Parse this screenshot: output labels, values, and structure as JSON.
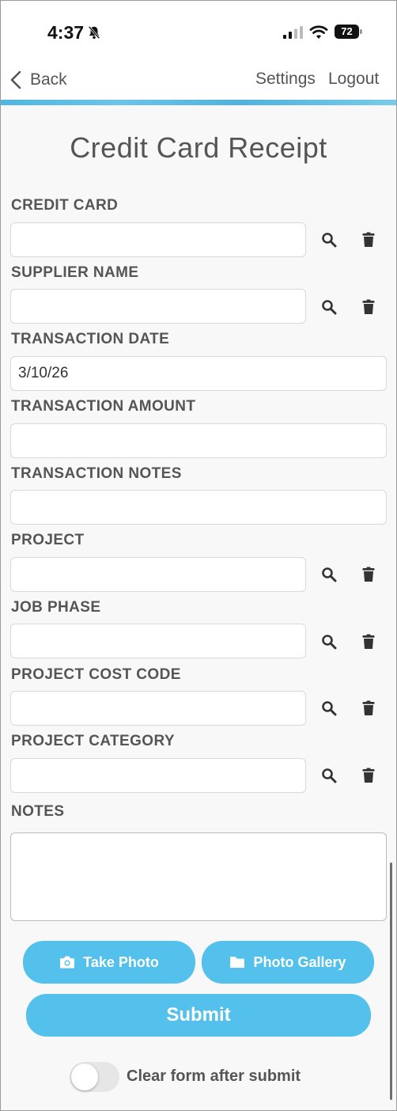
{
  "status_bar": {
    "time": "4:37",
    "battery": "72"
  },
  "nav": {
    "back_label": "Back",
    "settings_label": "Settings",
    "logout_label": "Logout"
  },
  "page_title": "Credit Card Receipt",
  "fields": {
    "credit_card": {
      "label": "CREDIT CARD",
      "value": ""
    },
    "supplier_name": {
      "label": "SUPPLIER NAME",
      "value": ""
    },
    "transaction_date": {
      "label": "TRANSACTION DATE",
      "value": "3/10/26"
    },
    "transaction_amount": {
      "label": "TRANSACTION AMOUNT",
      "value": ""
    },
    "transaction_notes": {
      "label": "TRANSACTION NOTES",
      "value": ""
    },
    "project": {
      "label": "PROJECT",
      "value": ""
    },
    "job_phase": {
      "label": "JOB PHASE",
      "value": ""
    },
    "project_cost_code": {
      "label": "PROJECT COST CODE",
      "value": ""
    },
    "project_category": {
      "label": "PROJECT CATEGORY",
      "value": ""
    },
    "notes": {
      "label": "NOTES",
      "value": ""
    }
  },
  "buttons": {
    "take_photo": "Take Photo",
    "photo_gallery": "Photo Gallery",
    "submit": "Submit"
  },
  "clear_form": {
    "label": "Clear form after submit",
    "enabled": false
  },
  "colors": {
    "accent": "#53c1ec",
    "text": "#555555",
    "background": "#f8f8f8"
  }
}
